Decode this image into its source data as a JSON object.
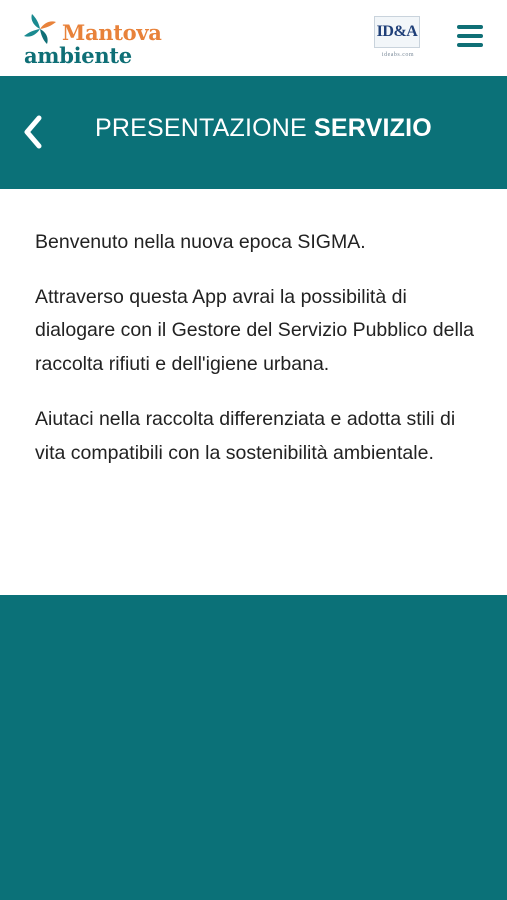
{
  "brand": {
    "name_line1": "Mantova",
    "name_line2": "ambiente",
    "partner_logo": "ID&A",
    "partner_domain": "ideabs.com",
    "colors": {
      "orange": "#e8823a",
      "teal": "#0b7178",
      "text": "#222222"
    }
  },
  "nav": {
    "menu_icon": "hamburger-menu-icon",
    "back_icon": "chevron-left-icon"
  },
  "header": {
    "title_part1": "PRESENTAZIONE",
    "title_part2": "SERVIZIO"
  },
  "content": {
    "paragraphs": [
      "Benvenuto nella nuova epoca SIGMA.",
      "Attraverso questa App avrai la possibilità di dialogare con il Gestore del Servizio Pubblico della raccolta rifiuti e dell'igiene urbana.",
      "Aiutaci nella raccolta differenziata e adotta stili di vita compatibili con la sostenibilità ambientale."
    ]
  }
}
